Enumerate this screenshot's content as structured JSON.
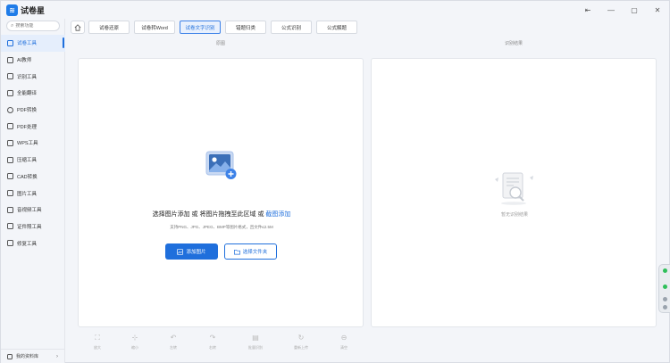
{
  "app": {
    "title": "试卷星",
    "logo_glyph": "≋"
  },
  "window_controls": {
    "pin": "⇤",
    "minimize": "—",
    "maximize": "▢",
    "close": "✕"
  },
  "search": {
    "placeholder": "搜索功能"
  },
  "sidebar": {
    "items": [
      {
        "label": "试卷工具",
        "icon": "test-paper-icon",
        "active": true
      },
      {
        "label": "AI教师",
        "icon": "ai-teacher-icon",
        "active": false
      },
      {
        "label": "识别工具",
        "icon": "scan-icon",
        "active": false
      },
      {
        "label": "全能翻译",
        "icon": "translate-icon",
        "active": false
      },
      {
        "label": "PDF转换",
        "icon": "pdf-convert-icon",
        "active": false
      },
      {
        "label": "PDF处理",
        "icon": "pdf-process-icon",
        "active": false
      },
      {
        "label": "WPS工具",
        "icon": "wps-icon",
        "active": false
      },
      {
        "label": "压缩工具",
        "icon": "compress-icon",
        "active": false
      },
      {
        "label": "CAD转换",
        "icon": "cad-icon",
        "active": false
      },
      {
        "label": "图片工具",
        "icon": "image-icon",
        "active": false
      },
      {
        "label": "音视频工具",
        "icon": "media-icon",
        "active": false
      },
      {
        "label": "证件照工具",
        "icon": "id-photo-icon",
        "active": false
      },
      {
        "label": "修复工具",
        "icon": "repair-icon",
        "active": false
      }
    ],
    "footer": {
      "label": "我的资料库",
      "chevron": "›"
    }
  },
  "tabs": [
    {
      "label": "试卷还原",
      "active": false
    },
    {
      "label": "试卷转Word",
      "active": false
    },
    {
      "label": "试卷文字识别",
      "active": true
    },
    {
      "label": "错题归类",
      "active": false
    },
    {
      "label": "公式识别",
      "active": false
    },
    {
      "label": "公式解题",
      "active": false
    }
  ],
  "panels": {
    "left_header": "原图",
    "right_header": "识别结果",
    "upload_hint_prefix": "选择图片添加 或 将图片拖拽至此区域 或 ",
    "upload_hint_link": "截图添加",
    "upload_subhint": "支持PNG、JPG、JPEG、BMP等图片格式，且文件≤2.5M",
    "add_image": "添加图片",
    "choose_folder": "选择文件夹",
    "empty_result": "暂无识别结果"
  },
  "toolbar": [
    {
      "label": "放大",
      "glyph": "⛶",
      "icon": "zoom-in-icon"
    },
    {
      "label": "缩小",
      "glyph": "⊹",
      "icon": "zoom-out-icon"
    },
    {
      "label": "左转",
      "glyph": "↶",
      "icon": "rotate-left-icon"
    },
    {
      "label": "右转",
      "glyph": "↷",
      "icon": "rotate-right-icon"
    },
    {
      "label": "批量识别",
      "glyph": "▤",
      "icon": "batch-recognize-icon"
    },
    {
      "label": "重新上传",
      "glyph": "↻",
      "icon": "reupload-icon"
    },
    {
      "label": "清空",
      "glyph": "⊖",
      "icon": "clear-icon"
    }
  ],
  "colors": {
    "accent": "#1f6fdc",
    "sidebar_active_bg": "#e5eefc",
    "widget_dot": "#2fbf5a"
  }
}
